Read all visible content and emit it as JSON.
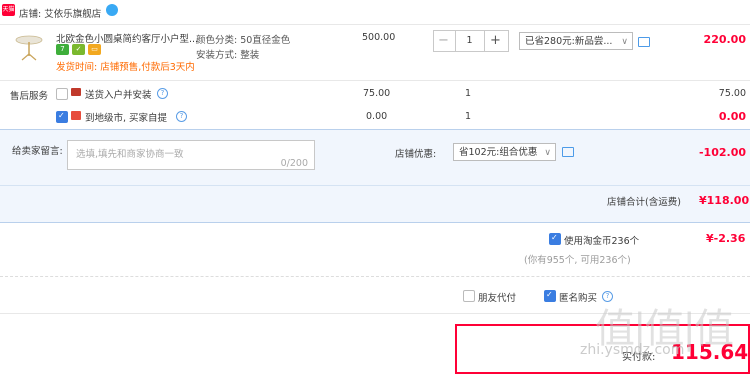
{
  "shop": {
    "badge": "天猫",
    "label": "店铺: 艾依乐旗舰店"
  },
  "item": {
    "title": "北欧金色小圆桌简约客厅小户型...",
    "attr_color": "颜色分类: 50直径金色",
    "attr_install": "安装方式: 整装",
    "ship_note": "发货时间: 店铺预售,付款后3天内",
    "unit_price": "500.00",
    "quantity": "1",
    "discount_select": "已省280元:新品尝...",
    "subtotal": "220.00"
  },
  "service": {
    "label": "售后服务",
    "opt1_label": "送货入户并安装",
    "opt1_price": "75.00",
    "opt1_qty": "1",
    "opt1_total": "75.00",
    "opt2_label": "到地级市, 买家自提",
    "opt2_price": "0.00",
    "opt2_qty": "1",
    "opt2_total": "0.00"
  },
  "message": {
    "label": "给卖家留言:",
    "placeholder": "选填,填先和商家协商一致",
    "counter": "0/200"
  },
  "shop_promo": {
    "label": "店铺优惠:",
    "select": "省102元:组合优惠",
    "value": "-102.00"
  },
  "shop_total": {
    "label": "店铺合计(含运费)",
    "value": "¥118.00"
  },
  "coins": {
    "label": "使用淘金币236个",
    "note": "(你有955个, 可用236个)",
    "value": "¥-2.36"
  },
  "options": {
    "friend_pay": "朋友代付",
    "anonymous": "匿名购买"
  },
  "pay": {
    "label": "实付款:",
    "amount": "115.64"
  },
  "watermark": {
    "big": "值|值|值",
    "small": "zhi.ysmdz.com"
  },
  "colors": {
    "accent": "#ff0036",
    "orange": "#ff6a00",
    "link_blue": "#3a7de1"
  }
}
